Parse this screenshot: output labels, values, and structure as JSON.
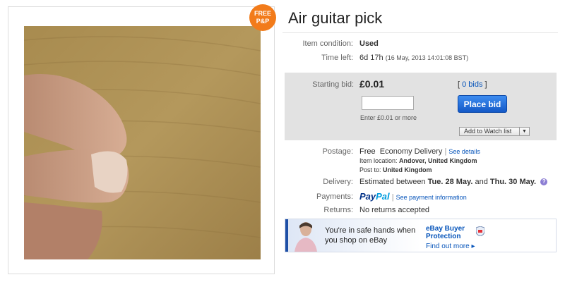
{
  "badge": {
    "line1": "FREE",
    "line2": "P&P"
  },
  "title": "Air guitar pick",
  "condition": {
    "label": "Item condition:",
    "value": "Used"
  },
  "time_left": {
    "label": "Time left:",
    "value": "6d 17h",
    "detail": "(16 May, 2013  14:01:08 BST)"
  },
  "bid": {
    "label": "Starting bid:",
    "value": "£0.01",
    "bids_open": "[ ",
    "bids_link": "0 bids",
    "bids_close": " ]",
    "input_value": "",
    "hint": "Enter £0.01 or more",
    "place_bid_label": "Place bid",
    "watch_label": "Add to Watch list",
    "watch_arrow": "▼"
  },
  "postage": {
    "label": "Postage:",
    "value": "Free",
    "service": "Economy Delivery",
    "separator": "|",
    "details_link": "See details",
    "location_label": "Item location:",
    "location": "Andover, United Kingdom",
    "post_to_label": "Post to:",
    "post_to": "United Kingdom"
  },
  "delivery": {
    "label": "Delivery:",
    "prefix": "Estimated between ",
    "start": "Tue. 28 May.",
    "and": " and ",
    "end": "Thu. 30 May.",
    "help": "?"
  },
  "payments": {
    "label": "Payments:",
    "pp_a": "Pay",
    "pp_b": "Pal",
    "separator": "|",
    "link": "See payment information"
  },
  "returns": {
    "label": "Returns:",
    "value": "No returns accepted"
  },
  "banner": {
    "message": "You're in safe hands when you shop on eBay",
    "title_line1": "eBay Buyer",
    "title_line2": "Protection",
    "link": "Find out more ▸"
  },
  "colors": {
    "badge": "#f27b1a",
    "link": "#0654ba",
    "button": "#1459c7",
    "bidbox": "#e2e2e2"
  },
  "icons": [
    "help-icon",
    "shield-icon",
    "dropdown-arrow-icon"
  ]
}
